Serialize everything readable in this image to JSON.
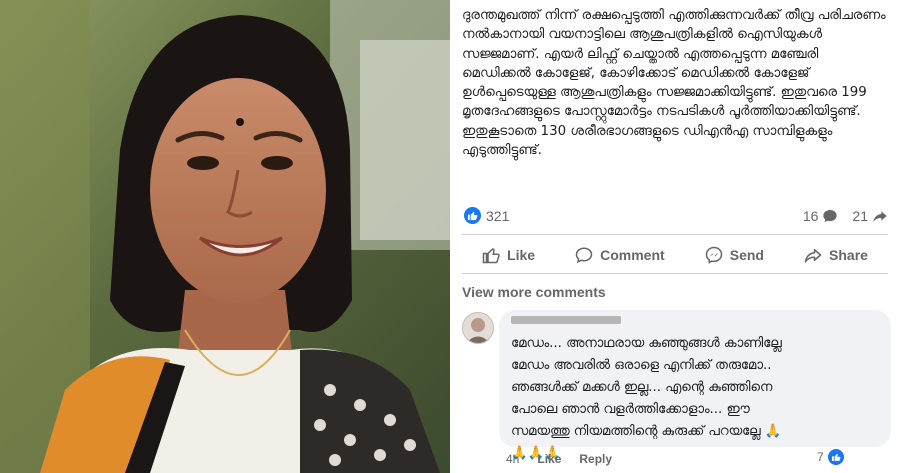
{
  "post": {
    "text": "ദുരന്തമുഖത്ത് നിന്ന് രക്ഷപ്പെടുത്തി എത്തിക്കുന്നവർക്ക് തീവ്ര പരിചരണം നൽകാനായി വയനാട്ടിലെ ആശുപത്രികളിൽ ഐസിയുകൾ സജ്ജമാണ്. എയർ ലിഫ്റ്റ് ചെയ്താൽ എത്തപ്പെടുന്ന മഞ്ചേരി മെഡിക്കൽ കോളേജ്, കോഴിക്കോട് മെഡിക്കൽ കോളേജ് ഉൾപ്പെടെയുള്ള ആശുപത്രികളും സജ്ജമാക്കിയിട്ടുണ്ട്. ഇതുവരെ 199 മൃതദേഹങ്ങളുടെ പോസ്റ്റുമോർട്ടം നടപടികൾ പൂർത്തിയാക്കിയിട്ടുണ്ട്. ഇതുകൂടാതെ 130 ശരീരഭാഗങ്ങളുടെ ഡിഎൻഎ സാമ്പിളുകളും എടുത്തിട്ടുണ്ട്."
  },
  "reactions": {
    "count": "321",
    "comments": "16",
    "shares": "21"
  },
  "actions": {
    "like": "Like",
    "comment": "Comment",
    "send": "Send",
    "share": "Share"
  },
  "view_more": "View more comments",
  "comment": {
    "text": "മേഡം... അനാഥരായ കുഞ്ഞുങ്ങൾ കാണില്ലേ\nമേഡം അവരിൽ ഒരാളെ എനിക്ക് തരുമോ..\nഞങ്ങൾക്ക് മക്കൾ ഇല്ല... എന്റെ കുഞ്ഞിനെ\nപോലെ ഞാൻ വളർത്തിക്കോളാം... ഈ\nസമയത്തു നിയമത്തിന്റെ കുരുക്ക് പറയല്ലേ 🙏\n🙏🙏🙏",
    "time": "4h",
    "like": "Like",
    "reply": "Reply",
    "reaction_count": "7"
  },
  "colors": {
    "facebook_blue": "#1877f2",
    "saree_orange": "#e08c2a",
    "text": "#1c1e21",
    "muted": "#65676b"
  }
}
